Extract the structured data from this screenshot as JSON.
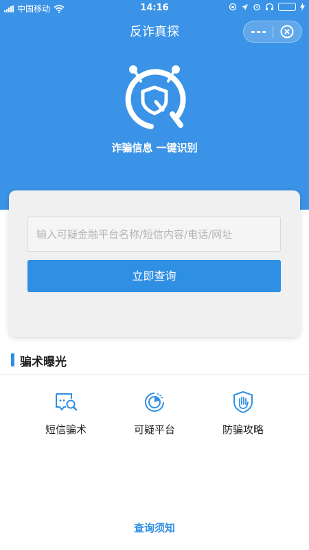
{
  "status_bar": {
    "carrier": "中国移动",
    "time": "14:16",
    "battery_color": "#5ad35a"
  },
  "navbar": {
    "title": "反诈真探",
    "more_icon": "more-dots-icon",
    "close_icon": "close-circle-icon"
  },
  "hero": {
    "logo_icon": "shield-search-robot-icon",
    "slogan": "诈骗信息 一键识别",
    "background_color": "#3a93e6"
  },
  "search": {
    "value": "",
    "placeholder": "输入可疑金融平台名称/短信内容/电话/网址",
    "button_label": "立即查询",
    "button_color": "#2f8fe3"
  },
  "exposure": {
    "title": "骗术曝光",
    "items": [
      {
        "label": "短信骗术",
        "icon": "sms-search-icon"
      },
      {
        "label": "可疑平台",
        "icon": "pie-clock-icon"
      },
      {
        "label": "防骗攻略",
        "icon": "hand-shield-icon"
      }
    ]
  },
  "footer": {
    "notice_link": "查询须知"
  }
}
